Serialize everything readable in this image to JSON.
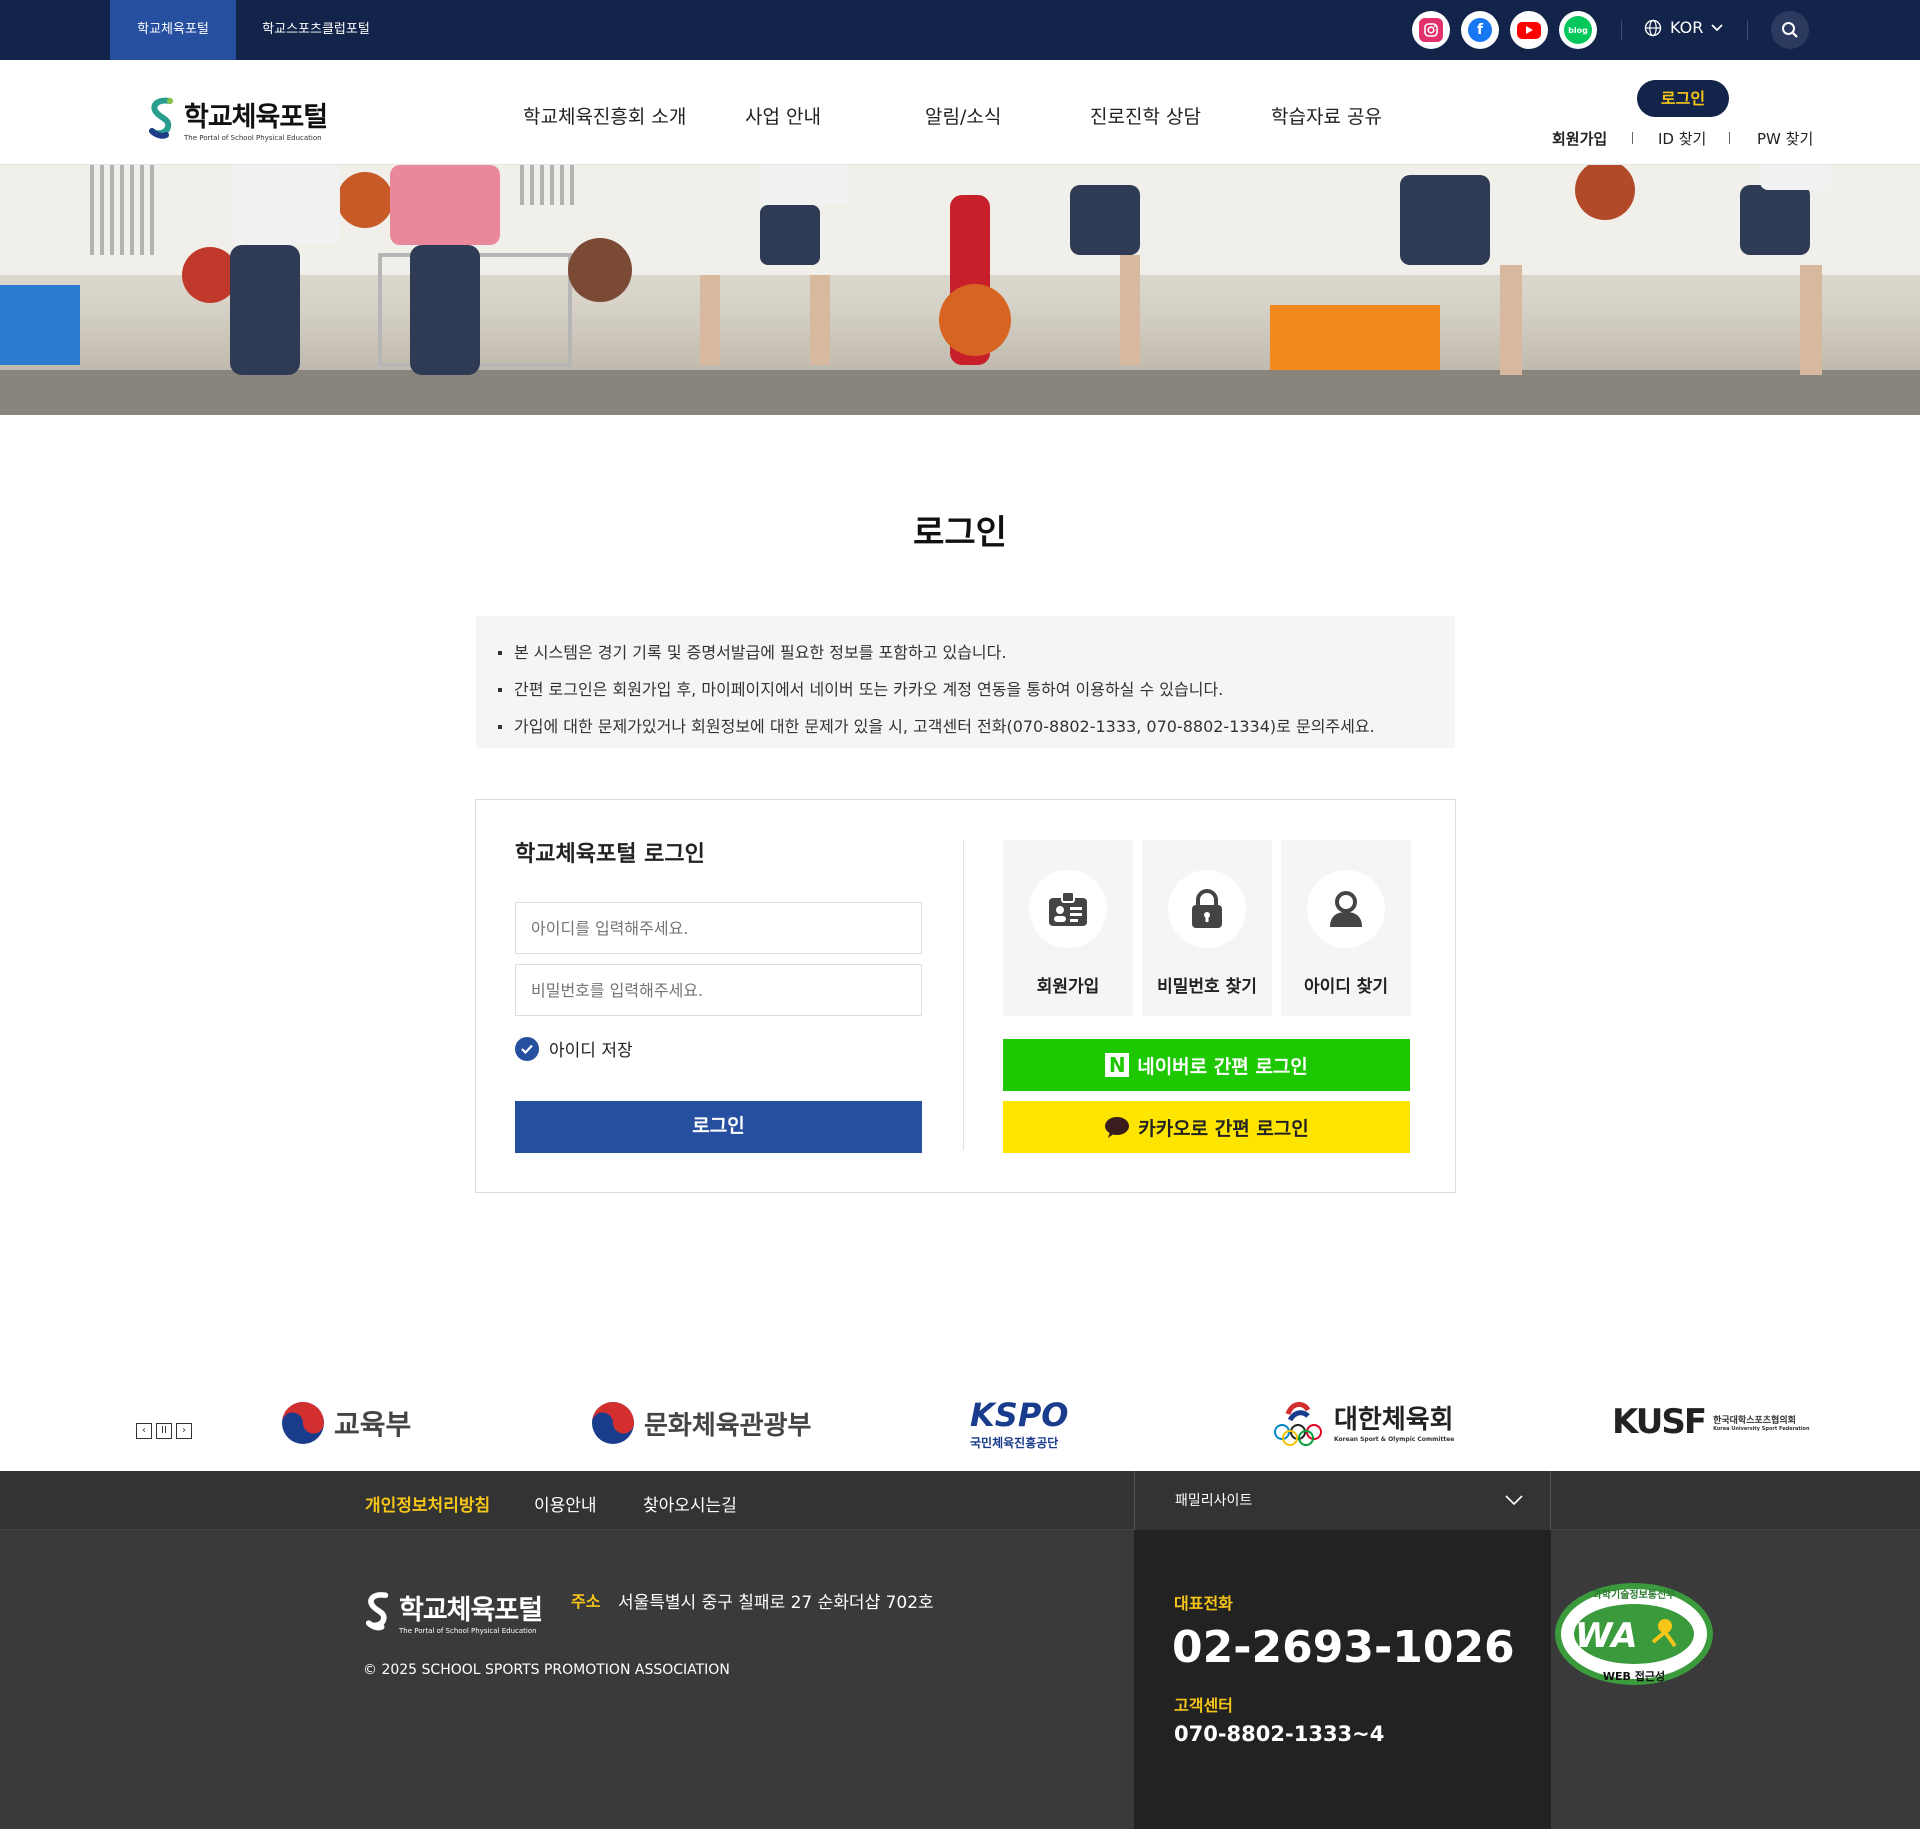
{
  "top_bar": {
    "tabs": [
      "학교체육포털",
      "학교스포츠클럽포털"
    ],
    "language": "KOR",
    "social_icons": [
      "instagram-icon",
      "facebook-icon",
      "youtube-icon",
      "blog-icon"
    ],
    "blog_label": "blog"
  },
  "header": {
    "logo_title": "학교체육포털",
    "logo_subtitle": "The Portal of School Physical Education",
    "nav": [
      "학교체육진흥회 소개",
      "사업 안내",
      "알림/소식",
      "진로진학 상담",
      "학습자료 공유"
    ],
    "login_button": "로그인",
    "utils": [
      "회원가입",
      "ID 찾기",
      "PW 찾기"
    ]
  },
  "page": {
    "title": "로그인",
    "notices": [
      "본 시스템은 경기 기록 및 증명서발급에 필요한 정보를 포함하고 있습니다.",
      "간편 로그인은 회원가입 후, 마이페이지에서 네이버 또는 카카오 계정 연동을 통하여 이용하실 수 있습니다.",
      "가입에 대한 문제가있거나 회원정보에 대한 문제가 있을 시, 고객센터 전화(070-8802-1333, 070-8802-1334)로 문의주세요."
    ]
  },
  "login_form": {
    "heading": "학교체육포털 로그인",
    "id_placeholder": "아이디를 입력해주세요.",
    "pw_placeholder": "비밀번호를 입력해주세요.",
    "save_id_label": "아이디 저장",
    "save_id_checked": true,
    "submit_label": "로그인"
  },
  "quick_links": [
    {
      "label": "회원가입",
      "icon": "id-card-icon"
    },
    {
      "label": "비밀번호 찾기",
      "icon": "lock-icon"
    },
    {
      "label": "아이디 찾기",
      "icon": "user-icon"
    }
  ],
  "sns_login": {
    "naver_label": "네이버로 간편 로그인",
    "naver_badge": "N",
    "kakao_label": "카카오로 간편 로그인"
  },
  "partners": {
    "controls": [
      "‹",
      "II",
      "›"
    ],
    "items": [
      "교육부",
      "문화체육관광부",
      "KSPO",
      "국민체육진흥공단",
      "대한체육회",
      "Korean Sport & Olympic Committee",
      "KUSF",
      "한국대학스포츠협의회",
      "Korea University Sport Federation"
    ]
  },
  "footer": {
    "links": [
      "개인정보처리방침",
      "이용안내",
      "찾아오시는길"
    ],
    "family_site": "패밀리사이트",
    "logo_title": "학교체육포털",
    "logo_subtitle": "The Portal of School Physical Education",
    "address_label": "주소",
    "address": "서울특별시 중구 칠패로 27 순화더샵 702호",
    "copyright": "© 2025 SCHOOL SPORTS PROMOTION ASSOCIATION",
    "tel_label": "대표전화",
    "tel": "02-2693-1026",
    "cs_label": "고객센터",
    "cs": "070-8802-1333~4",
    "wa_badge": "WA",
    "wa_top": "과학기술정보통신부",
    "wa_bottom": "WEB 접근성"
  },
  "colors": {
    "navy": "#13244a",
    "blue": "#264fa0",
    "accent_yellow": "#f5c518",
    "naver_green": "#1ec800",
    "kakao_yellow": "#fee500",
    "footer_dark": "#333333"
  }
}
